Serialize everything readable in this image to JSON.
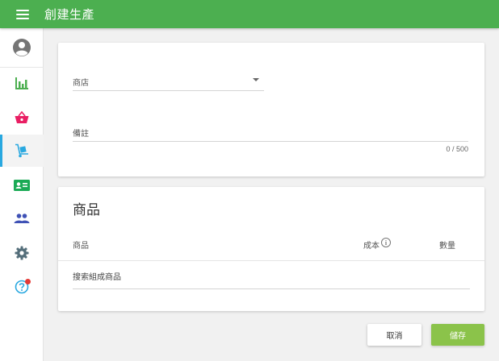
{
  "header": {
    "title": "創建生產"
  },
  "colors": {
    "topbar": "#4caf50",
    "save_button": "#8bc34a",
    "active_indicator": "#29a8e0"
  },
  "sidebar": {
    "items": [
      {
        "name": "profile",
        "icon": "account-circle-icon",
        "color": "#757575"
      },
      {
        "name": "analytics",
        "icon": "bar-chart-icon",
        "color": "#4caf50"
      },
      {
        "name": "shop",
        "icon": "basket-icon",
        "color": "#e91e63"
      },
      {
        "name": "production",
        "icon": "hand-truck-icon",
        "color": "#29a8e0",
        "active": true
      },
      {
        "name": "contacts",
        "icon": "contact-card-icon",
        "color": "#1aaa55"
      },
      {
        "name": "users",
        "icon": "people-icon",
        "color": "#3f51b5"
      },
      {
        "name": "settings",
        "icon": "gear-icon",
        "color": "#546e7a"
      },
      {
        "name": "help",
        "icon": "help-icon",
        "color": "#29a8e0",
        "badge": true
      }
    ]
  },
  "form": {
    "shop_label": "商店",
    "note_label": "備註",
    "note_counter": "0 / 500"
  },
  "products": {
    "title": "商品",
    "columns": {
      "product": "商品",
      "cost": "成本",
      "quantity": "數量"
    },
    "search_placeholder": "搜索組成商品"
  },
  "actions": {
    "cancel": "取消",
    "save": "儲存"
  }
}
